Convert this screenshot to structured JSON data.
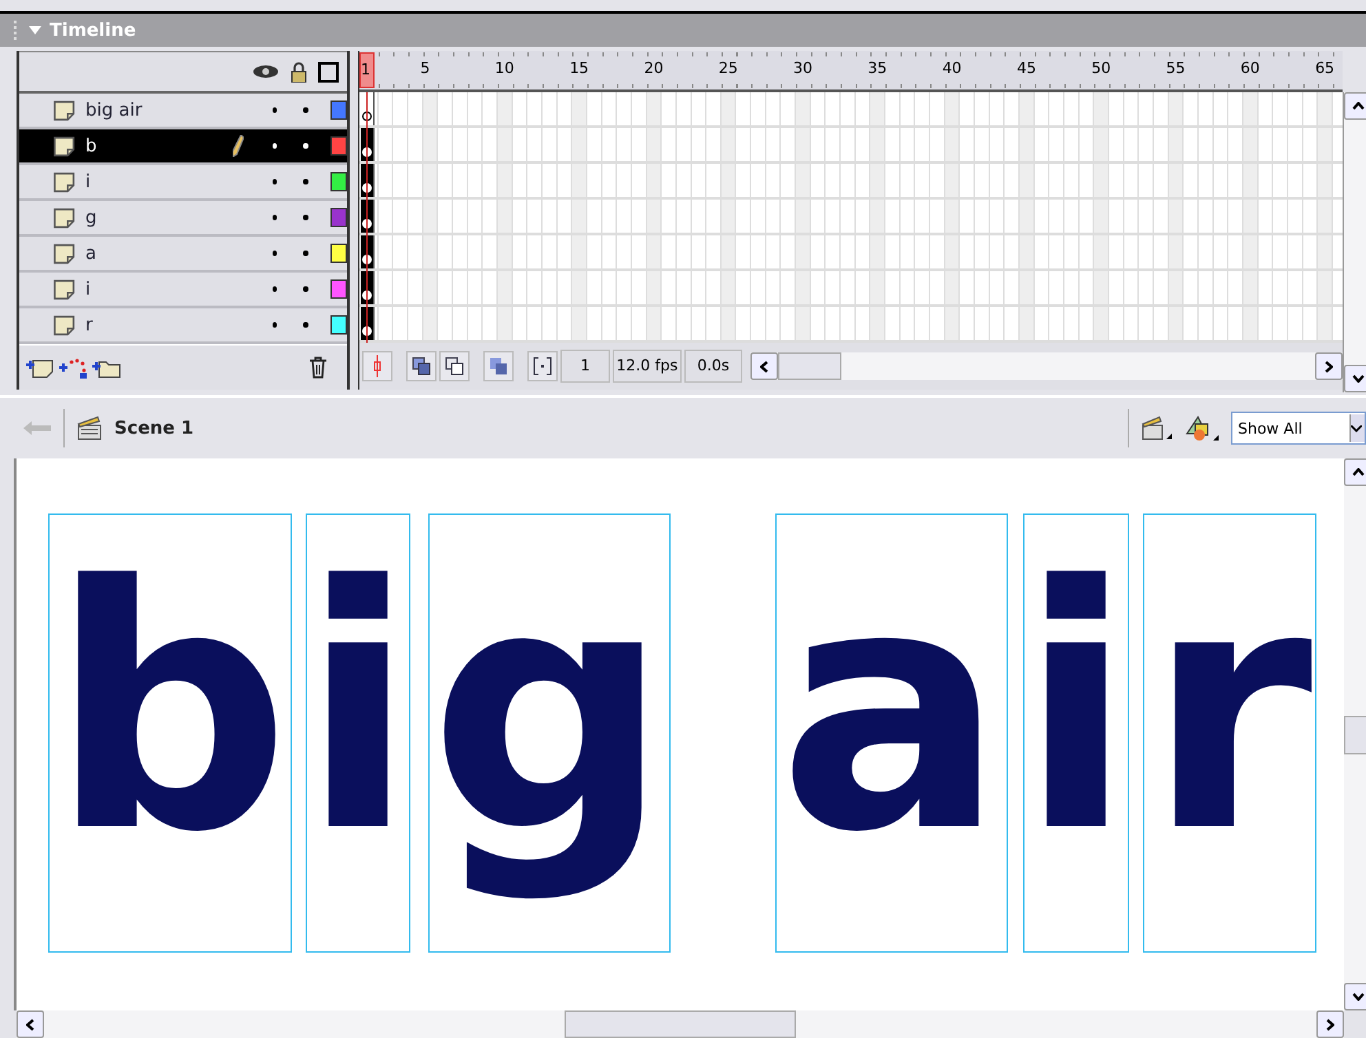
{
  "panel": {
    "title": "Timeline"
  },
  "ruler": {
    "labels": [
      "1",
      "5",
      "10",
      "15",
      "20",
      "25",
      "30",
      "35",
      "40",
      "45",
      "50",
      "55",
      "60",
      "65"
    ]
  },
  "layers": [
    {
      "name": "big air",
      "selected": false,
      "editing": false,
      "color": "#4477ff",
      "frame_selected": false
    },
    {
      "name": "b",
      "selected": true,
      "editing": true,
      "color": "#ff4444",
      "frame_selected": true
    },
    {
      "name": "i",
      "selected": false,
      "editing": false,
      "color": "#33ee44",
      "frame_selected": true
    },
    {
      "name": "g",
      "selected": false,
      "editing": false,
      "color": "#9933cc",
      "frame_selected": true
    },
    {
      "name": "a",
      "selected": false,
      "editing": false,
      "color": "#ffff44",
      "frame_selected": true
    },
    {
      "name": "i",
      "selected": false,
      "editing": false,
      "color": "#ff55ff",
      "frame_selected": true
    },
    {
      "name": "r",
      "selected": false,
      "editing": false,
      "color": "#44ffff",
      "frame_selected": true
    }
  ],
  "status": {
    "frame": "1",
    "fps": "12.0 fps",
    "time": "0.0s"
  },
  "edit_bar": {
    "scene": "Scene 1",
    "zoom": "Show All"
  },
  "stage": {
    "letters": [
      {
        "text": "b"
      },
      {
        "text": "i"
      },
      {
        "text": "g"
      },
      {
        "text": "a"
      },
      {
        "text": "i"
      },
      {
        "text": "r"
      }
    ]
  }
}
